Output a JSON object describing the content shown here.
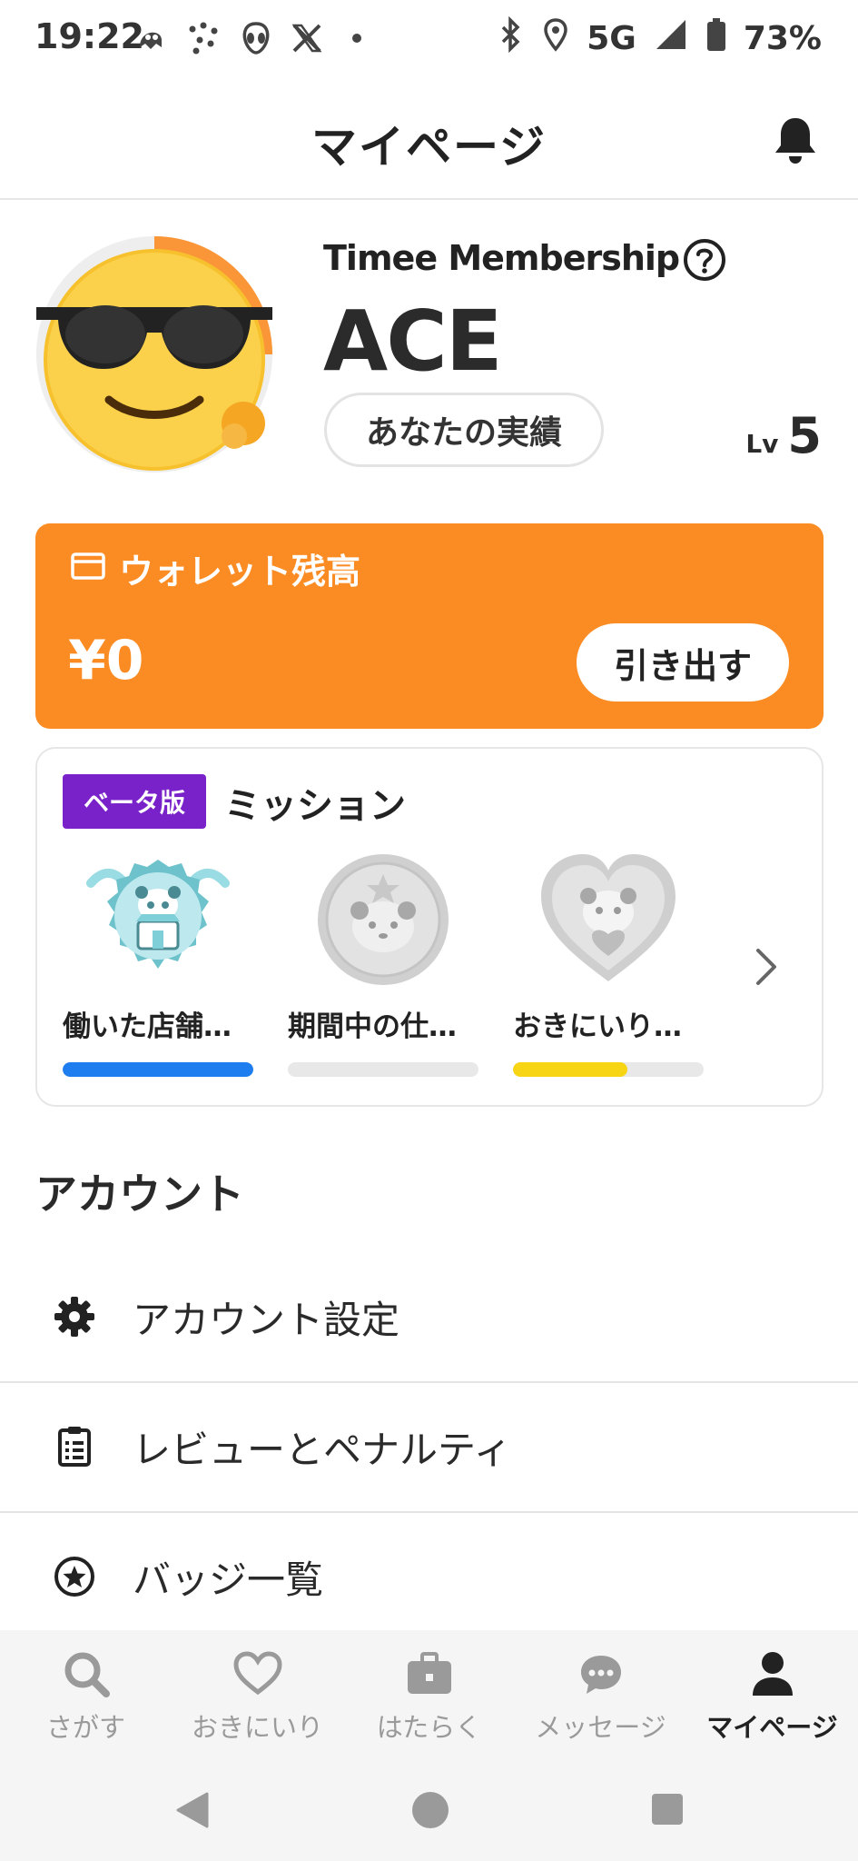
{
  "status_bar": {
    "time": "19:22",
    "left_icons": [
      "phantom-icon",
      "dots-icon",
      "alien-icon",
      "x-logo-icon",
      "dot-icon"
    ],
    "right_icons": [
      "bluetooth-icon",
      "location-icon",
      "signal-icon",
      "battery-icon"
    ],
    "network": "5G",
    "battery": "73%"
  },
  "header": {
    "title": "マイページ",
    "bell_icon": "bell-icon"
  },
  "profile": {
    "membership_label": "Timee Membership",
    "rank": "ACE",
    "achievements_button": "あなたの実績",
    "level_prefix": "Lv",
    "level_value": "5",
    "avatar": "sunglasses-emoji-avatar"
  },
  "wallet": {
    "title": "ウォレット残高",
    "amount": "¥0",
    "withdraw_button": "引き出す",
    "icon": "card-icon"
  },
  "missions": {
    "beta_badge": "ベータ版",
    "title": "ミッション",
    "items": [
      {
        "label": "働いた店舗…",
        "progress": 1.0,
        "color": "#1e7ef0",
        "icon": "panda-store-badge-icon"
      },
      {
        "label": "期間中の仕…",
        "progress": 0.0,
        "color": "#e8e8e8",
        "icon": "panda-coin-badge-icon"
      },
      {
        "label": "おきにいり…",
        "progress": 0.6,
        "color": "#f7d414",
        "icon": "panda-heart-badge-icon"
      }
    ]
  },
  "account": {
    "section_title": "アカウント",
    "items": [
      {
        "label": "アカウント設定",
        "icon": "gear-icon"
      },
      {
        "label": "レビューとペナルティ",
        "icon": "clipboard-list-icon"
      },
      {
        "label": "バッジ一覧",
        "icon": "star-circle-icon"
      }
    ]
  },
  "bottom_nav": {
    "items": [
      {
        "label": "さがす",
        "icon": "search-icon",
        "active": false
      },
      {
        "label": "おきにいり",
        "icon": "heart-icon",
        "active": false
      },
      {
        "label": "はたらく",
        "icon": "briefcase-icon",
        "active": false
      },
      {
        "label": "メッセージ",
        "icon": "chat-icon",
        "active": false
      },
      {
        "label": "マイページ",
        "icon": "person-icon",
        "active": true
      }
    ]
  },
  "colors": {
    "accent_orange": "#fb8c23",
    "beta_purple": "#7a22c9",
    "progress_blue": "#1e7ef0",
    "progress_yellow": "#f7d414"
  }
}
